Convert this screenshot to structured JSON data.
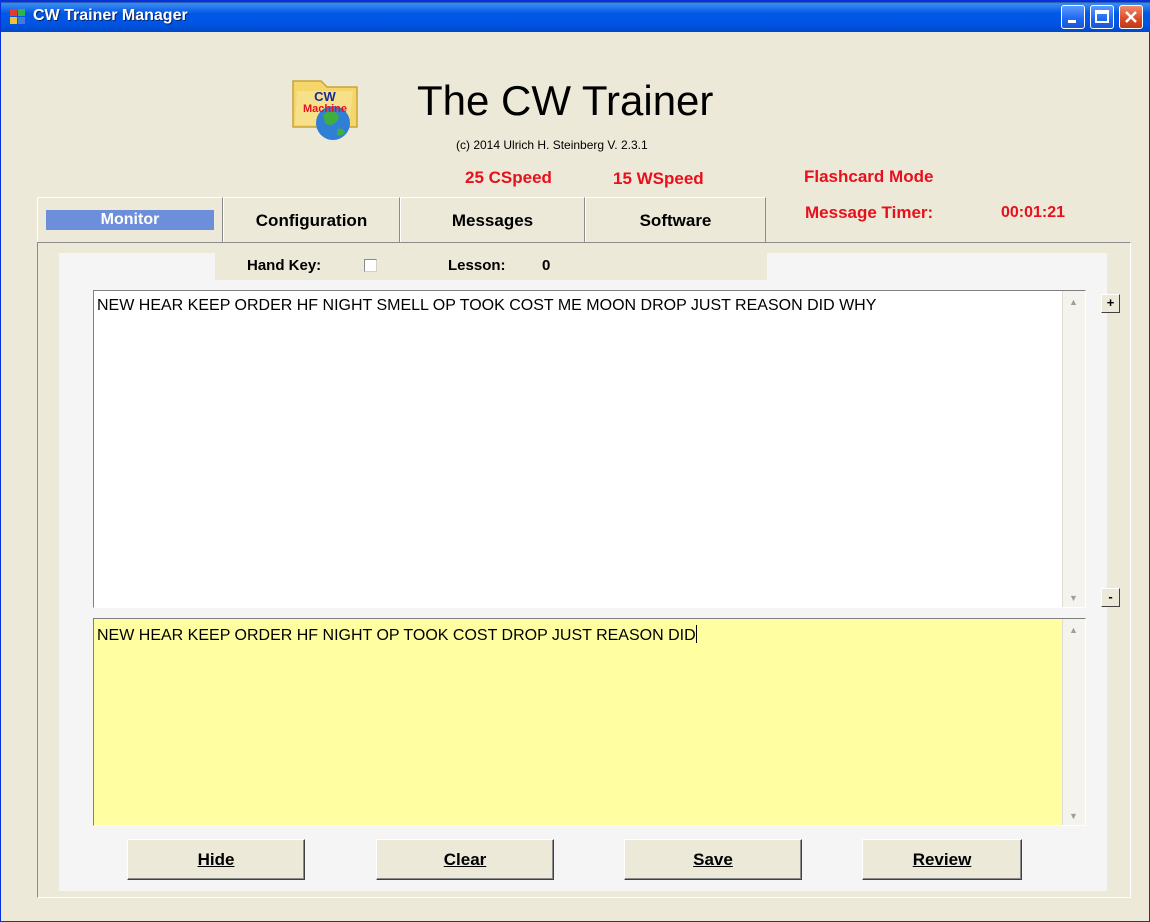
{
  "window": {
    "title": "CW Trainer Manager"
  },
  "header": {
    "app_title": "The CW Trainer",
    "copyright": "(c)  2014 Ulrich H. Steinberg     V. 2.3.1",
    "cspeed": "25  CSpeed",
    "wspeed": "15  WSpeed",
    "mode": "Flashcard Mode",
    "timer_label": "Message Timer:",
    "timer_value": "00:01:21",
    "logo_text_top": "CW",
    "logo_text_bottom": "Machine"
  },
  "tabs": [
    {
      "label": "Monitor",
      "selected": true
    },
    {
      "label": "Configuration"
    },
    {
      "label": "Messages"
    },
    {
      "label": "Software"
    }
  ],
  "monitor": {
    "hand_key_label": "Hand Key:",
    "hand_key_checked": false,
    "lesson_label": "Lesson:",
    "lesson_value": "0",
    "sent_text": "NEW HEAR KEEP ORDER HF NIGHT SMELL OP TOOK COST ME MOON DROP JUST REASON DID WHY",
    "received_text": "NEW HEAR KEEP ORDER HF NIGHT OP TOOK COST DROP JUST REASON DID",
    "plus_label": "+",
    "minus_label": "-",
    "buttons": {
      "hide": "Hide",
      "clear": "Clear",
      "save": "Save",
      "review": "Review"
    }
  },
  "colors": {
    "accent_red": "#E8101C",
    "selected_tab": "#6D8EDA",
    "received_bg": "#FFFFA1",
    "titlebar": "#0055E5"
  },
  "icons": [
    "app-icon",
    "minimize-icon",
    "maximize-icon",
    "close-icon",
    "cw-machine-logo",
    "scroll-up-icon",
    "scroll-down-icon"
  ]
}
